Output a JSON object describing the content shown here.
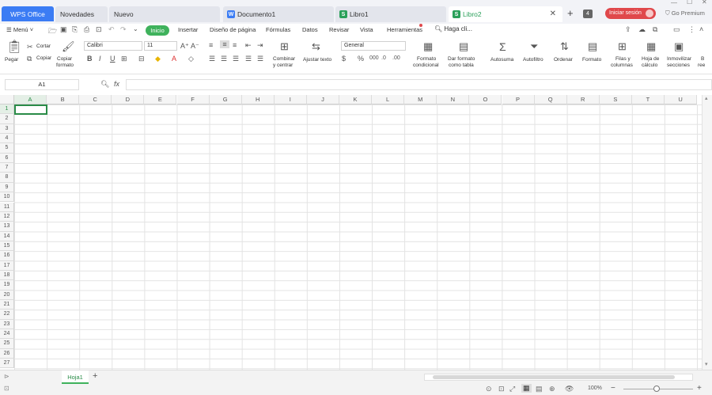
{
  "titlebar": {
    "tabs": [
      {
        "label": "WPS Office"
      },
      {
        "label": "Novedades"
      },
      {
        "label": "Nuevo"
      },
      {
        "label": "Documento1",
        "icon": "W"
      },
      {
        "label": "Libro1",
        "icon": "S"
      },
      {
        "label": "Libro2",
        "icon": "S"
      }
    ],
    "badge": "4",
    "login": "Iniciar sesión",
    "premium": "Go Premium"
  },
  "menubar": {
    "menu": "Menú",
    "tabs": [
      "Inicio",
      "Insertar",
      "Diseño de página",
      "Fórmulas",
      "Datos",
      "Revisar",
      "Vista",
      "Herramientas"
    ],
    "search": "Haga cli..."
  },
  "ribbon": {
    "paste": "Pegar",
    "cut": "Cortar",
    "copy": "Copiar",
    "copy_format_1": "Copiar",
    "copy_format_2": "formato",
    "font": "Calibri",
    "size": "11",
    "combine_1": "Combinar",
    "combine_2": "y centrar",
    "wrap": "Ajustar texto",
    "number_format": "General",
    "cond_1": "Formato",
    "cond_2": "condicional",
    "table_1": "Dar formato",
    "table_2": "como tabla",
    "autosum": "Autosuma",
    "autofilter": "Autofiltro",
    "sort": "Ordenar",
    "format": "Formato",
    "rows_1": "Filas y",
    "rows_2": "columnas",
    "sheet_1": "Hoja de",
    "sheet_2": "cálculo",
    "freeze_1": "Inmovilizar",
    "freeze_2": "secciones",
    "trunc_1": "B",
    "trunc_2": "ree"
  },
  "formula": {
    "cell_ref": "A1",
    "fx": "fx"
  },
  "grid": {
    "columns": [
      "A",
      "B",
      "C",
      "D",
      "E",
      "F",
      "G",
      "H",
      "I",
      "J",
      "K",
      "L",
      "M",
      "N",
      "O",
      "P",
      "Q",
      "R",
      "S",
      "T",
      "U"
    ],
    "rows": [
      "1",
      "2",
      "3",
      "4",
      "5",
      "6",
      "7",
      "8",
      "9",
      "10",
      "11",
      "12",
      "13",
      "14",
      "15",
      "16",
      "17",
      "18",
      "19",
      "20",
      "21",
      "22",
      "23",
      "24",
      "25",
      "26",
      "27"
    ]
  },
  "sheets": {
    "active": "Hoja1",
    "add": "+"
  },
  "status": {
    "zoom": "100%"
  },
  "colors": {
    "accent": "#3b7cf4",
    "green": "#3fb25c",
    "login": "#e0484b"
  }
}
